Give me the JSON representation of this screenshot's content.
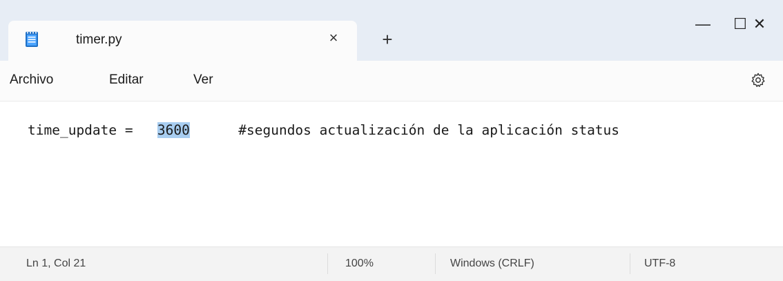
{
  "tab": {
    "title": "timer.py",
    "close_glyph": "×",
    "icon": "notepad-icon"
  },
  "new_tab_glyph": "+",
  "window_controls": {
    "minimize": "—",
    "maximize": "☐",
    "close": "✕"
  },
  "menu": {
    "archivo": "Archivo",
    "editar": "Editar",
    "ver": "Ver"
  },
  "settings_icon": "gear-icon",
  "editor": {
    "line_prefix": "time_update =   ",
    "selected_value": "3600",
    "line_suffix": "      #segundos actualización de la aplicación status"
  },
  "status": {
    "position": "Ln 1, Col 21",
    "zoom": "100%",
    "line_ending": "Windows (CRLF)",
    "encoding": "UTF-8"
  },
  "colors": {
    "titlebar": "#e7edf5",
    "selection": "#a8cdf0",
    "icon_blue": "#1e6fc5"
  }
}
